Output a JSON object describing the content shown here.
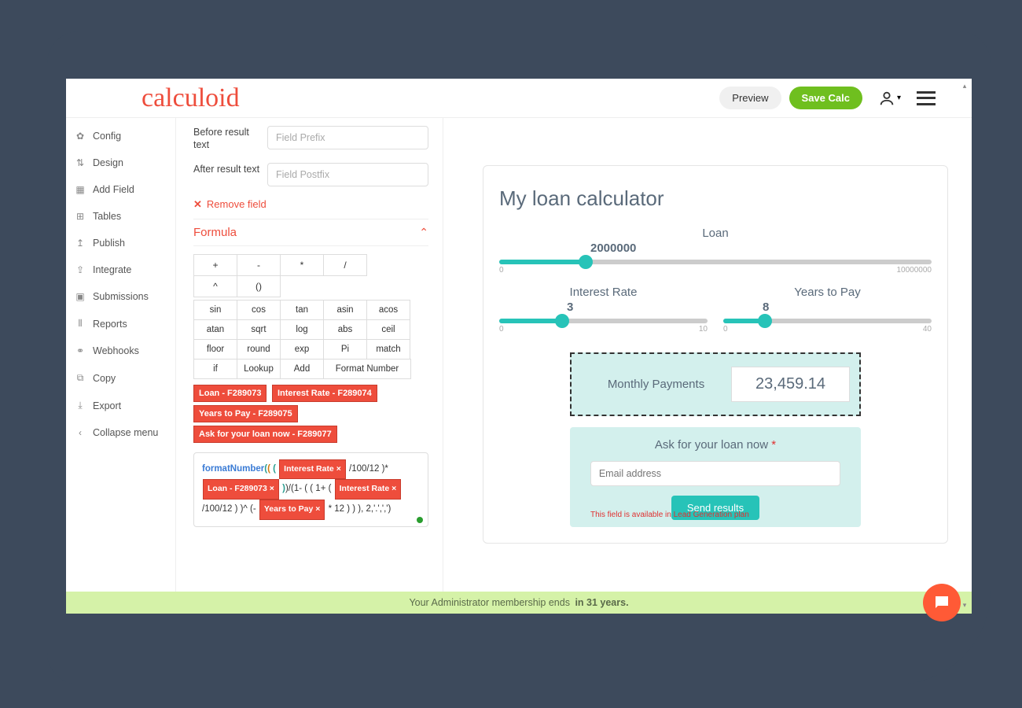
{
  "topbar": {
    "logo": "calculoid",
    "preview_label": "Preview",
    "save_label": "Save Calc"
  },
  "sidebar": {
    "items": [
      {
        "icon": "✿",
        "label": "Config"
      },
      {
        "icon": "⇅",
        "label": "Design"
      },
      {
        "icon": "▦",
        "label": "Add Field"
      },
      {
        "icon": "⊞",
        "label": "Tables"
      },
      {
        "icon": "↥",
        "label": "Publish"
      },
      {
        "icon": "⇪",
        "label": "Integrate"
      },
      {
        "icon": "▣",
        "label": "Submissions"
      },
      {
        "icon": "⫴",
        "label": "Reports"
      },
      {
        "icon": "⚭",
        "label": "Webhooks"
      },
      {
        "icon": "⧉",
        "label": "Copy"
      },
      {
        "icon": "⤓",
        "label": "Export"
      },
      {
        "icon": "‹",
        "label": "Collapse menu"
      }
    ]
  },
  "editor": {
    "before_label": "Before result text",
    "before_placeholder": "Field Prefix",
    "after_label": "After result text",
    "after_placeholder": "Field Postfix",
    "remove_field": "Remove field",
    "formula_section": "Formula",
    "ops": [
      "+",
      "-",
      "*",
      "/",
      "^",
      "()"
    ],
    "fns": [
      "sin",
      "cos",
      "tan",
      "asin",
      "acos",
      "atan",
      "sqrt",
      "log",
      "abs",
      "ceil",
      "floor",
      "round",
      "exp",
      "Pi",
      "match",
      "if",
      "Lookup",
      "Add"
    ],
    "fn_wide": "Format Number",
    "field_tags": [
      "Loan - F289073",
      "Interest Rate - F289074",
      "Years to Pay - F289075",
      "Ask for your loan now - F289077"
    ],
    "formula_fn": "formatNumber",
    "formula_token_ir": "Interest Rate ×",
    "formula_token_loan": "Loan - F289073 ×",
    "formula_token_years": "Years to Pay ×",
    "formula_seg1": "/100/12 )*",
    "formula_seg2": ")/(1- ( ( 1+ (",
    "formula_seg3": "/100/12 ) )^ (-",
    "formula_seg4": "* 12 )  )  ), 2,'.',',')"
  },
  "preview": {
    "title": "My loan calculator",
    "loan": {
      "label": "Loan",
      "value": "2000000",
      "min": "0",
      "max": "10000000",
      "pct": 20
    },
    "rate": {
      "label": "Interest Rate",
      "value": "3",
      "min": "0",
      "max": "10",
      "pct": 30
    },
    "years": {
      "label": "Years to Pay",
      "value": "8",
      "min": "0",
      "max": "40",
      "pct": 20
    },
    "result_label": "Monthly Payments",
    "result_value": "23,459.14",
    "lead_title": "Ask for your loan now",
    "email_placeholder": "Email address",
    "send_label": "Send results",
    "lead_note": "This field is available in Lead Generation plan"
  },
  "footer": {
    "text": "Your Administrator membership ends",
    "bold": "in 31 years."
  }
}
